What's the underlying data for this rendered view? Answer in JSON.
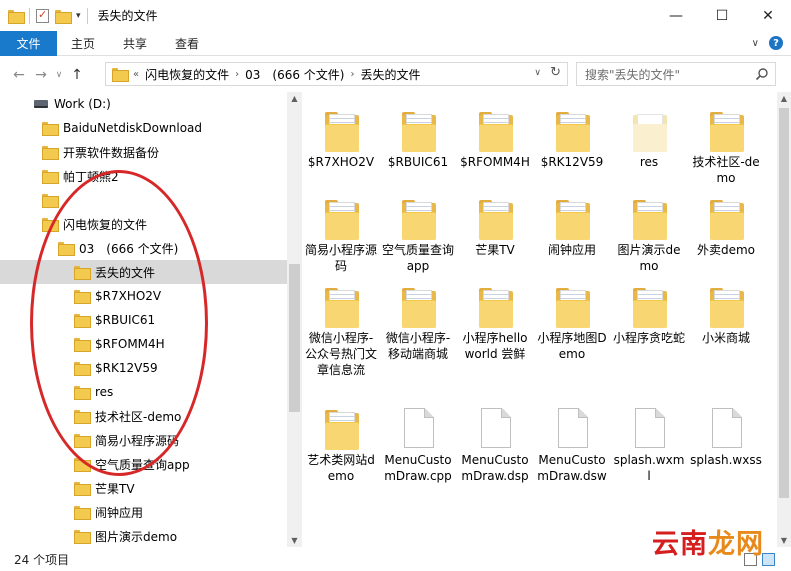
{
  "window": {
    "title": "丢失的文件",
    "controls": {
      "minimize": "—",
      "maximize": "☐",
      "close": "✕"
    }
  },
  "ribbon": {
    "tabs": [
      "文件",
      "主页",
      "共享",
      "查看"
    ],
    "collapse_glyph": "∨",
    "help_glyph": "?"
  },
  "nav": {
    "back": "←",
    "forward": "→",
    "recent": "∨",
    "up": "↑",
    "overflow": "«",
    "breadcrumb": [
      "闪电恢复的文件",
      "03　(666 个文件)",
      "丢失的文件"
    ],
    "crumb_sep": "›",
    "dropdown": "∨",
    "refresh": "↻"
  },
  "search": {
    "placeholder": "搜索\"丢失的文件\""
  },
  "tree": [
    {
      "label": "Work (D:)",
      "icon": "drive-icon",
      "indent": 1
    },
    {
      "label": "BaiduNetdiskDownload",
      "icon": "folder-icon",
      "indent": 2
    },
    {
      "label": "开票软件数据备份",
      "icon": "folder-icon",
      "indent": 2
    },
    {
      "label": "帕丁顿熊2",
      "icon": "folder-icon",
      "indent": 2
    },
    {
      "label": "",
      "icon": "folder-icon",
      "indent": 2
    },
    {
      "label": "闪电恢复的文件",
      "icon": "folder-icon",
      "indent": 2
    },
    {
      "label": "03　(666 个文件)",
      "icon": "folder-icon",
      "indent": 3
    },
    {
      "label": "丢失的文件",
      "icon": "folder-icon",
      "indent": 4,
      "selected": true
    },
    {
      "label": "$R7XHO2V",
      "icon": "folder-icon",
      "indent": 5
    },
    {
      "label": "$RBUIC61",
      "icon": "folder-icon",
      "indent": 5
    },
    {
      "label": "$RFOMM4H",
      "icon": "folder-icon",
      "indent": 5
    },
    {
      "label": "$RK12V59",
      "icon": "folder-icon",
      "indent": 5
    },
    {
      "label": "res",
      "icon": "folder-icon",
      "indent": 5
    },
    {
      "label": "技术社区-demo",
      "icon": "folder-icon",
      "indent": 5
    },
    {
      "label": "简易小程序源码",
      "icon": "folder-icon",
      "indent": 5
    },
    {
      "label": "空气质量查询app",
      "icon": "folder-icon",
      "indent": 5
    },
    {
      "label": "芒果TV",
      "icon": "folder-icon",
      "indent": 5
    },
    {
      "label": "闹钟应用",
      "icon": "folder-icon",
      "indent": 5
    },
    {
      "label": "图片演示demo",
      "icon": "folder-icon",
      "indent": 5
    }
  ],
  "items": [
    {
      "label": "$R7XHO2V",
      "type": "folder"
    },
    {
      "label": "$RBUIC61",
      "type": "folder"
    },
    {
      "label": "$RFOMM4H",
      "type": "folder"
    },
    {
      "label": "$RK12V59",
      "type": "folder"
    },
    {
      "label": "res",
      "type": "folder-ghost"
    },
    {
      "label": "技术社区-demo",
      "type": "folder"
    },
    {
      "label": "简易小程序源码",
      "type": "folder"
    },
    {
      "label": "空气质量查询app",
      "type": "folder"
    },
    {
      "label": "芒果TV",
      "type": "folder"
    },
    {
      "label": "闹钟应用",
      "type": "folder"
    },
    {
      "label": "图片演示demo",
      "type": "folder"
    },
    {
      "label": "外卖demo",
      "type": "folder"
    },
    {
      "label": "微信小程序-公众号热门文章信息流",
      "type": "folder"
    },
    {
      "label": "微信小程序-移动端商城",
      "type": "folder"
    },
    {
      "label": "小程序hello world 尝鲜",
      "type": "folder"
    },
    {
      "label": "小程序地图Demo",
      "type": "folder"
    },
    {
      "label": "小程序贪吃蛇",
      "type": "folder"
    },
    {
      "label": "小米商城",
      "type": "folder"
    },
    {
      "label": "艺术类网站demo",
      "type": "folder"
    },
    {
      "label": "MenuCustomDraw.cpp",
      "type": "file"
    },
    {
      "label": "MenuCustomDraw.dsp",
      "type": "file"
    },
    {
      "label": "MenuCustomDraw.dsw",
      "type": "file"
    },
    {
      "label": "splash.wxml",
      "type": "file"
    },
    {
      "label": "splash.wxss",
      "type": "file"
    }
  ],
  "status": {
    "count": "24 个项目"
  },
  "watermark": {
    "part1": "云南",
    "part2": "龙网"
  },
  "colors": {
    "accent": "#1979ca",
    "annotation": "#d62828",
    "selection": "#d9d9d9"
  }
}
